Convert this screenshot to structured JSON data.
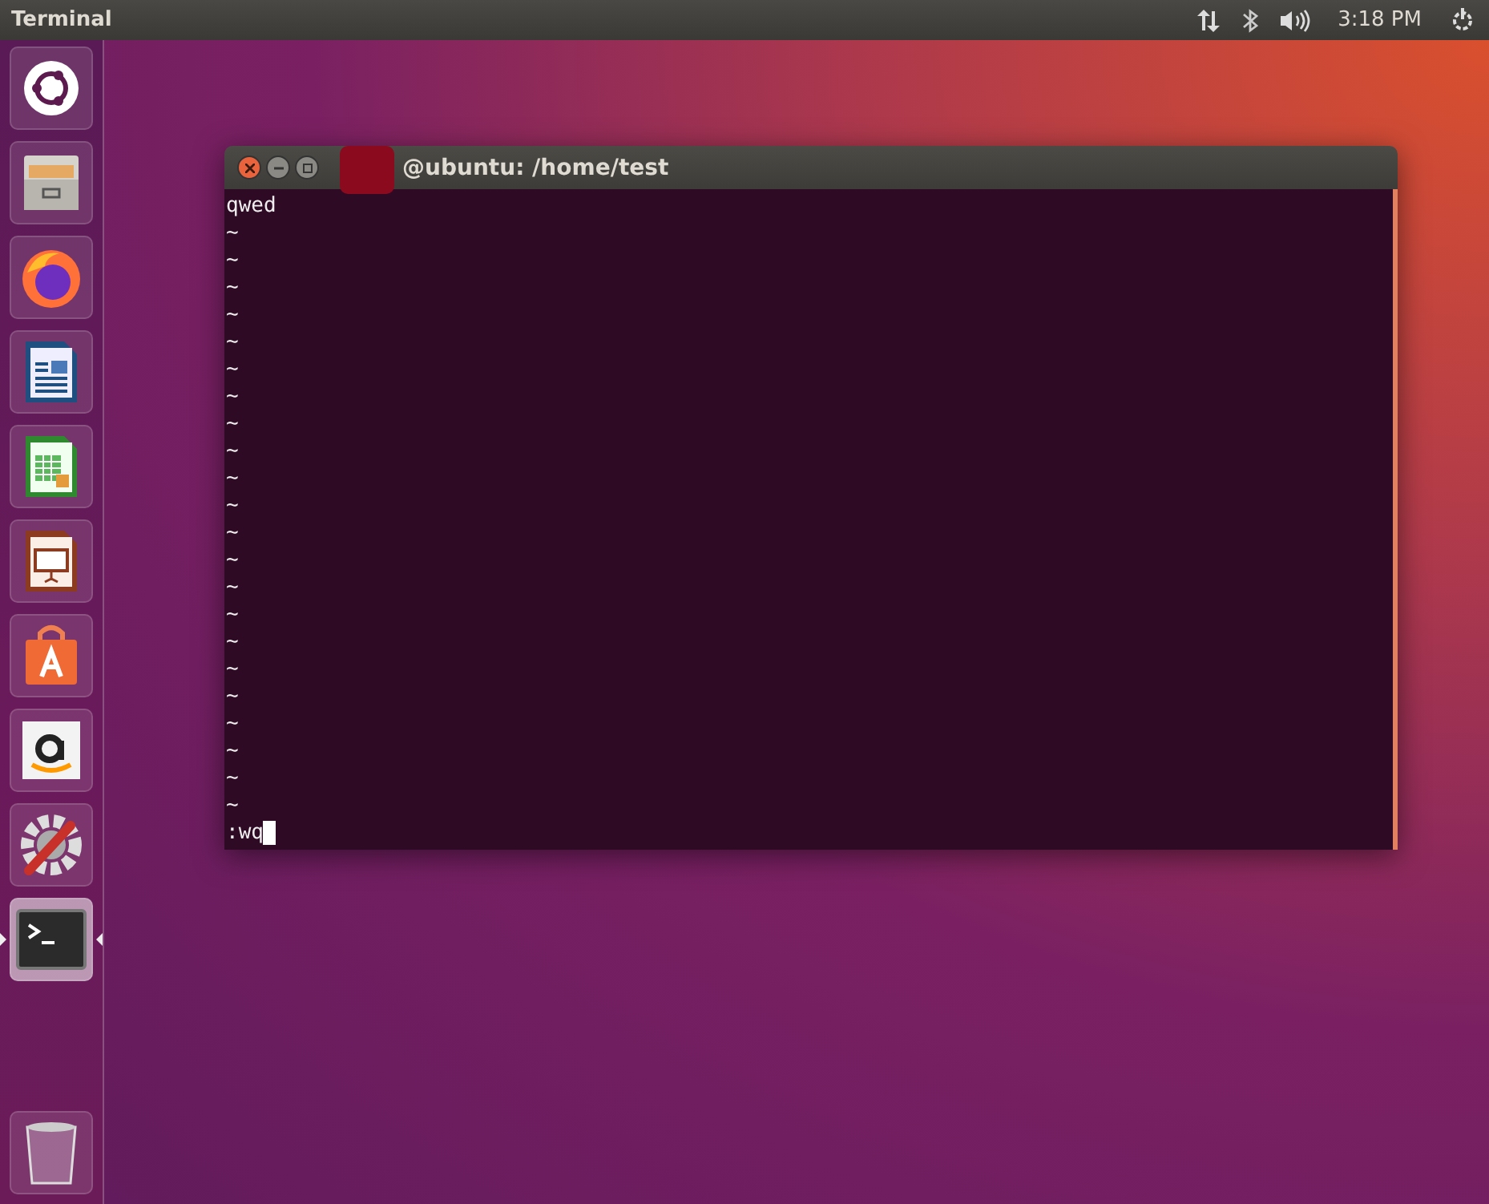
{
  "top_bar": {
    "app_title": "Terminal",
    "clock": "3:18 PM"
  },
  "launcher": {
    "items": [
      {
        "kind": "dash",
        "selected": false
      },
      {
        "kind": "files",
        "selected": false
      },
      {
        "kind": "browser",
        "selected": false
      },
      {
        "kind": "writer",
        "selected": false
      },
      {
        "kind": "calc",
        "selected": false
      },
      {
        "kind": "impress",
        "selected": false
      },
      {
        "kind": "store",
        "selected": false
      },
      {
        "kind": "amazon",
        "selected": false
      },
      {
        "kind": "settings",
        "selected": false
      },
      {
        "kind": "terminal",
        "selected": true
      }
    ],
    "trash": {
      "kind": "trash"
    }
  },
  "window": {
    "title": "@ubuntu: /home/test",
    "redacted_user": true,
    "lines": [
      "qwed",
      "~",
      "~",
      "~",
      "~",
      "~",
      "~",
      "~",
      "~",
      "~",
      "~",
      "~",
      "~",
      "~",
      "~",
      "~",
      "~",
      "~",
      "~",
      "~",
      "~",
      "~",
      "~"
    ],
    "command": ":wq"
  }
}
